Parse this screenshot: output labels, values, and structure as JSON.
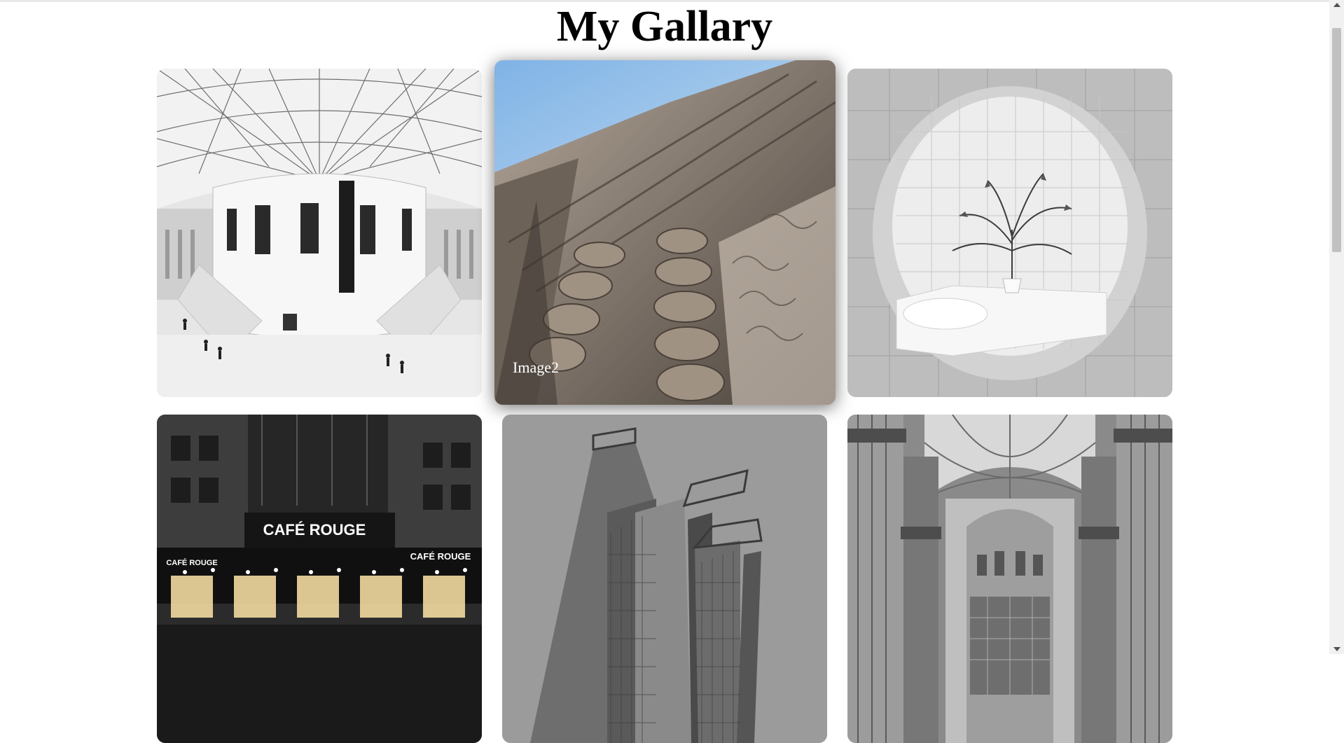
{
  "page": {
    "title": "My Gallary"
  },
  "gallery": {
    "items": [
      {
        "name": "rotunda-image",
        "caption": ""
      },
      {
        "name": "column-facade-image",
        "caption": "Image2"
      },
      {
        "name": "tiled-room-plant-image",
        "caption": ""
      },
      {
        "name": "cafe-rouge-image",
        "caption": ""
      },
      {
        "name": "skyscraper-image",
        "caption": ""
      },
      {
        "name": "cathedral-interior-image",
        "caption": ""
      }
    ],
    "signage": {
      "cafe_main": "CAFÉ ROUGE",
      "cafe_side_right": "CAFÉ ROUGE",
      "cafe_side_left": "CAFÉ ROUGE"
    }
  }
}
